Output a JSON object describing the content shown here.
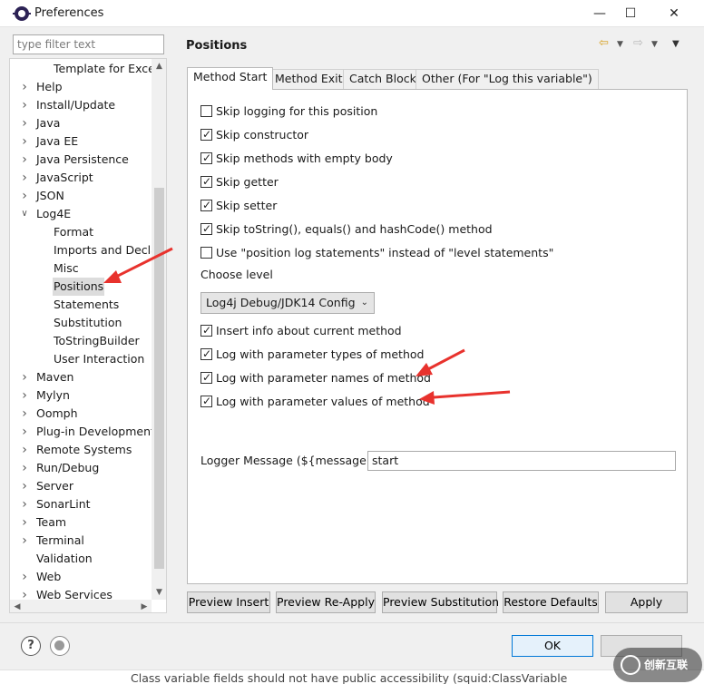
{
  "window": {
    "title": "Preferences"
  },
  "filter": {
    "placeholder": "type filter text"
  },
  "tree": {
    "items": [
      {
        "label": "Template for Exce",
        "level": 1,
        "expander": ""
      },
      {
        "label": "Help",
        "level": 0,
        "expander": "collapsed"
      },
      {
        "label": "Install/Update",
        "level": 0,
        "expander": "collapsed"
      },
      {
        "label": "Java",
        "level": 0,
        "expander": "collapsed"
      },
      {
        "label": "Java EE",
        "level": 0,
        "expander": "collapsed"
      },
      {
        "label": "Java Persistence",
        "level": 0,
        "expander": "collapsed"
      },
      {
        "label": "JavaScript",
        "level": 0,
        "expander": "collapsed"
      },
      {
        "label": "JSON",
        "level": 0,
        "expander": "collapsed"
      },
      {
        "label": "Log4E",
        "level": 0,
        "expander": "expanded"
      },
      {
        "label": "Format",
        "level": 1,
        "expander": ""
      },
      {
        "label": "Imports and Decla",
        "level": 1,
        "expander": ""
      },
      {
        "label": "Misc",
        "level": 1,
        "expander": ""
      },
      {
        "label": "Positions",
        "level": 1,
        "expander": "",
        "selected": true
      },
      {
        "label": "Statements",
        "level": 1,
        "expander": ""
      },
      {
        "label": "Substitution",
        "level": 1,
        "expander": ""
      },
      {
        "label": "ToStringBuilder",
        "level": 1,
        "expander": ""
      },
      {
        "label": "User Interaction",
        "level": 1,
        "expander": ""
      },
      {
        "label": "Maven",
        "level": 0,
        "expander": "collapsed"
      },
      {
        "label": "Mylyn",
        "level": 0,
        "expander": "collapsed"
      },
      {
        "label": "Oomph",
        "level": 0,
        "expander": "collapsed"
      },
      {
        "label": "Plug-in Development",
        "level": 0,
        "expander": "collapsed"
      },
      {
        "label": "Remote Systems",
        "level": 0,
        "expander": "collapsed"
      },
      {
        "label": "Run/Debug",
        "level": 0,
        "expander": "collapsed"
      },
      {
        "label": "Server",
        "level": 0,
        "expander": "collapsed"
      },
      {
        "label": "SonarLint",
        "level": 0,
        "expander": "collapsed"
      },
      {
        "label": "Team",
        "level": 0,
        "expander": "collapsed"
      },
      {
        "label": "Terminal",
        "level": 0,
        "expander": "collapsed"
      },
      {
        "label": "Validation",
        "level": 0,
        "expander": ""
      },
      {
        "label": "Web",
        "level": 0,
        "expander": "collapsed"
      },
      {
        "label": "Web Services",
        "level": 0,
        "expander": "collapsed"
      }
    ]
  },
  "page": {
    "title": "Positions"
  },
  "tabs": [
    {
      "label": "Method Start",
      "active": true
    },
    {
      "label": "Method Exit",
      "active": false
    },
    {
      "label": "Catch Block",
      "active": false
    },
    {
      "label": "Other (For \"Log this variable\")",
      "active": false
    }
  ],
  "options_top": [
    {
      "label": "Skip logging for this position",
      "checked": false
    },
    {
      "label": "Skip constructor",
      "checked": true
    },
    {
      "label": "Skip methods with empty body",
      "checked": true
    },
    {
      "label": "Skip getter",
      "checked": true
    },
    {
      "label": "Skip setter",
      "checked": true
    },
    {
      "label": "Skip toString(), equals() and hashCode() method",
      "checked": true
    },
    {
      "label": "Use \"position log statements\" instead of \"level statements\"",
      "checked": false
    }
  ],
  "choose_level": {
    "label": "Choose level",
    "value": "Log4j Debug/JDK14 Config"
  },
  "options_bottom": [
    {
      "label": "Insert info about current method",
      "checked": true
    },
    {
      "label": "Log with parameter types of method",
      "checked": true
    },
    {
      "label": "Log with parameter names of method",
      "checked": true
    },
    {
      "label": "Log with parameter values of method",
      "checked": true
    }
  ],
  "logger_message": {
    "label": "Logger Message (${message})",
    "value": "start"
  },
  "page_buttons": {
    "preview_insert": "Preview Insert",
    "preview_reapply": "Preview Re-Apply",
    "preview_substitution": "Preview Substitution",
    "restore_defaults": "Restore Defaults",
    "apply": "Apply"
  },
  "dialog_buttons": {
    "ok": "OK"
  },
  "background": {
    "text": "Class variable fields should not have public accessibility (squid:ClassVariable"
  },
  "watermark": {
    "text": "创新互联"
  },
  "colors": {
    "annotation_arrow": "#e8322d",
    "ok_border": "#0078d7"
  }
}
